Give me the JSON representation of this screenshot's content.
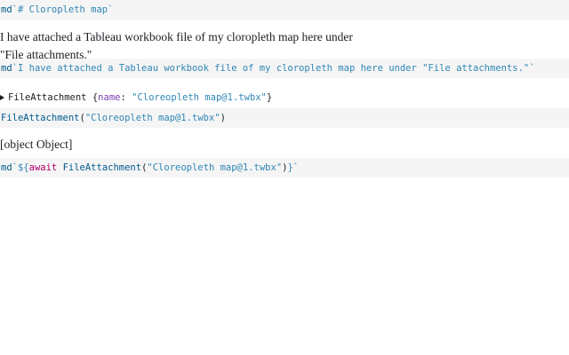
{
  "cells": [
    {
      "id": "cell-1",
      "code": {
        "tag": "md",
        "open": "`",
        "body": "# Cloropleth map",
        "close": "`"
      }
    },
    {
      "id": "cell-2",
      "output": "I have attached a Tableau workbook file of my cloropleth map here under \"File attachments.\"",
      "code": {
        "tag": "md",
        "open": "`",
        "body": "I have attached a Tableau workbook file of my cloropleth map here under \"File attachments.\"",
        "close": "`"
      }
    },
    {
      "id": "cell-3",
      "inspector": {
        "class_name": "FileAttachment",
        "open_brace": "{",
        "key": "name",
        "colon": ":",
        "value": "\"Cloreopleth map@1.twbx\"",
        "close_brace": "}"
      },
      "code": {
        "fn": "FileAttachment",
        "open_paren": "(",
        "arg": "\"Cloreopleth map@1.twbx\"",
        "close_paren": ")"
      }
    },
    {
      "id": "cell-4",
      "output": "[object Object]",
      "code": {
        "tag": "md",
        "open": "`${",
        "await": "await",
        "fn": "FileAttachment",
        "open_paren": "(",
        "arg": "\"Cloreopleth map@1.twbx\"",
        "close_paren": ")",
        "close": "}`"
      }
    }
  ]
}
